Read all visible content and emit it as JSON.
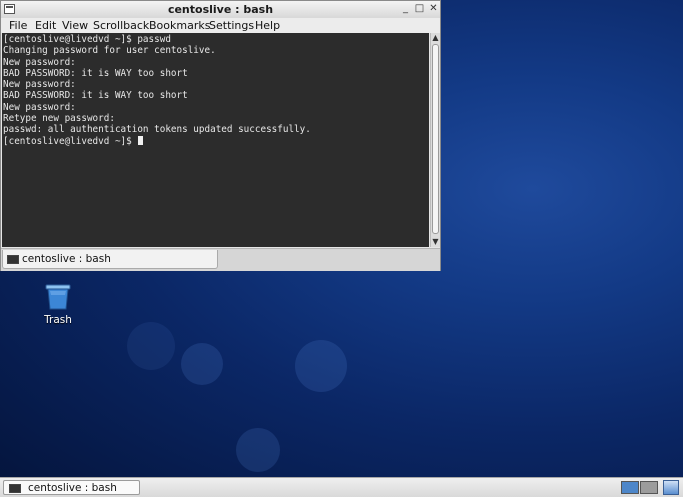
{
  "window": {
    "title": "centoslive : bash",
    "controls": {
      "minimize": "_",
      "maximize": "□",
      "close": "✕"
    }
  },
  "menu": [
    "File",
    "Edit",
    "View",
    "Scrollback",
    "Bookmarks",
    "Settings",
    "Help"
  ],
  "terminal": {
    "lines": [
      "[centoslive@livedvd ~]$ passwd",
      "Changing password for user centoslive.",
      "New password:",
      "BAD PASSWORD: it is WAY too short",
      "New password:",
      "BAD PASSWORD: it is WAY too short",
      "New password:",
      "Retype new password:",
      "passwd: all authentication tokens updated successfully."
    ],
    "prompt": "[centoslive@livedvd ~]$ "
  },
  "tab": {
    "label": "centoslive : bash"
  },
  "desktop": {
    "trash_label": "Trash"
  },
  "taskbar": {
    "window_label": "centoslive : bash"
  },
  "colors": {
    "terminal_bg": "#2c2c2c",
    "terminal_fg": "#e8e8e8",
    "desktop": "#0b2766",
    "workspace_active": "#4d86c9"
  }
}
